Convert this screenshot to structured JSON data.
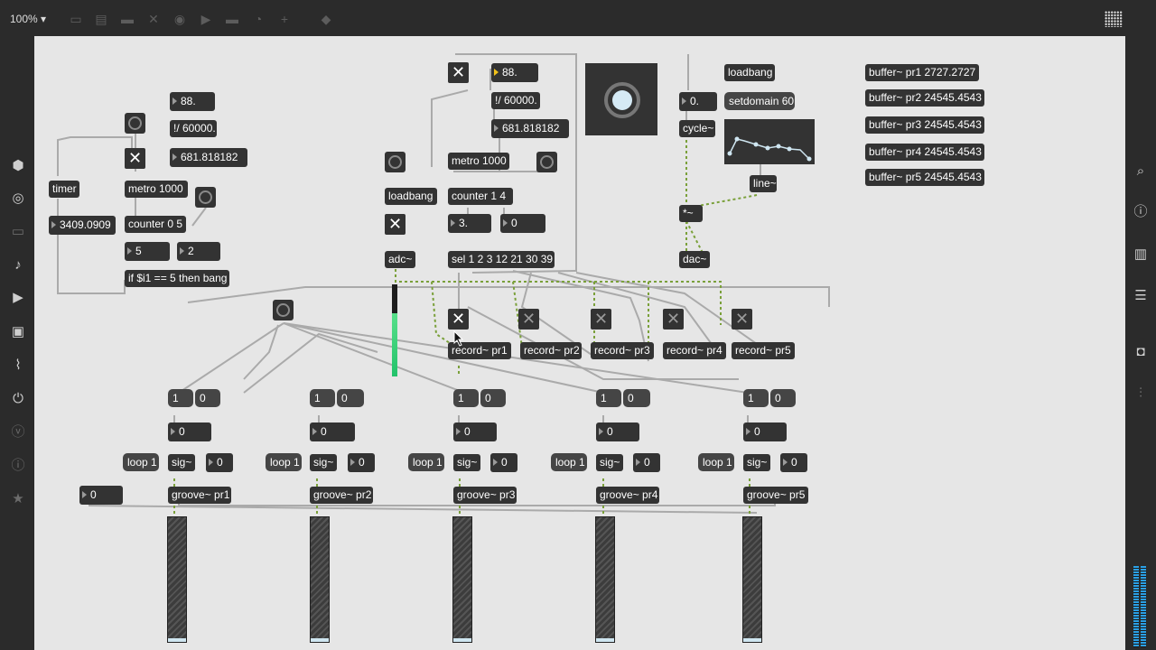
{
  "toolbar": {
    "zoom_label": "100% ▾"
  },
  "left_sidebar": {
    "icons": [
      "cube-icon",
      "target-icon",
      "bed-icon",
      "music-note-icon",
      "play-list-icon",
      "image-icon",
      "paperclip-icon",
      "plug-icon",
      "vst-icon",
      "info-circle-icon",
      "star-icon"
    ]
  },
  "right_sidebar": {
    "icons": [
      "search-icon",
      "info-icon",
      "book-icon",
      "list-icon",
      "camera-icon",
      "mixer-icon"
    ]
  },
  "objects": {
    "timer": "timer",
    "timer_out": "3409.0909",
    "tempo_left": "88.",
    "div_left": "!/ 60000.",
    "ms_left": "681.818182",
    "metro_left": "metro 1000",
    "counter_left": "counter 0 5",
    "num5": "5",
    "num2": "2",
    "if_obj": "if $i1 == 5 then bang",
    "tempo_mid": "88.",
    "div_mid": "!/ 60000.",
    "ms_mid": "681.818182",
    "metro_mid": "metro 1000",
    "loadbang_mid": "loadbang",
    "counter_mid": "counter 1 4",
    "num3": "3.",
    "num0a": "0",
    "adc": "adc~",
    "sel": "sel 1 2 3 12 21 30 39",
    "num_cycle": "0.",
    "cycle": "cycle~",
    "loadbang_right": "loadbang",
    "setdomain": "setdomain 60",
    "line": "line~",
    "mult": "*~",
    "dac": "dac~",
    "buffers": [
      "buffer~ pr1 2727.2727",
      "buffer~ pr2 24545.4543",
      "buffer~ pr3 24545.4543",
      "buffer~ pr4 24545.4543",
      "buffer~ pr5 24545.4543"
    ],
    "records": [
      "record~ pr1",
      "record~ pr2",
      "record~ pr3",
      "record~ pr4",
      "record~ pr5"
    ],
    "one_msg": "1",
    "zero_msg": "0",
    "num_zero": "0",
    "loop_msg": "loop 1",
    "sig": "sig~",
    "grooves": [
      "groove~ pr1",
      "groove~ pr2",
      "groove~ pr3",
      "groove~ pr4",
      "groove~ pr5"
    ],
    "num_bottom_left": "0"
  },
  "colors": {
    "canvas": "#e6e6e6",
    "object": "#333333",
    "meter": "#2aa0e6",
    "level": "#3ad07a",
    "signal_patch": "#8ab04a"
  }
}
